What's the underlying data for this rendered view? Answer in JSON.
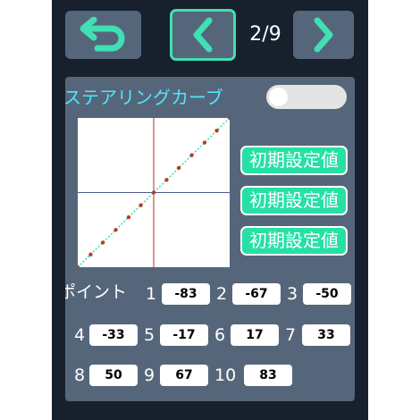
{
  "nav": {
    "back_icon": "undo-arrow-icon",
    "prev_icon": "chevron-left-icon",
    "next_icon": "chevron-right-icon",
    "page_indicator": "2/9"
  },
  "colors": {
    "background": "#17202d",
    "button": "#56667a",
    "accent": "#3fe0b3",
    "title": "#4fe6ff",
    "reset_button": "#27e0a6",
    "curve_line": "#3fe0b3",
    "curve_point": "#c0392b"
  },
  "section": {
    "title": "ステアリングカーブ",
    "toggle_on": false
  },
  "reset_buttons": [
    "初期設定値",
    "初期設定値",
    "初期設定値"
  ],
  "points_label": "ポイント",
  "points": [
    {
      "index": "1",
      "value": "-83"
    },
    {
      "index": "2",
      "value": "-67"
    },
    {
      "index": "3",
      "value": "-50"
    },
    {
      "index": "4",
      "value": "-33"
    },
    {
      "index": "5",
      "value": "-17"
    },
    {
      "index": "6",
      "value": "17"
    },
    {
      "index": "7",
      "value": "33"
    },
    {
      "index": "8",
      "value": "50"
    },
    {
      "index": "9",
      "value": "67"
    },
    {
      "index": "10",
      "value": "83"
    }
  ],
  "chart_data": {
    "type": "line",
    "x": [
      -100,
      -83,
      -67,
      -50,
      -33,
      -17,
      0,
      17,
      33,
      50,
      67,
      83,
      100
    ],
    "y": [
      -100,
      -83,
      -67,
      -50,
      -33,
      -17,
      0,
      17,
      33,
      50,
      67,
      83,
      100
    ],
    "xlim": [
      -100,
      100
    ],
    "ylim": [
      -100,
      100
    ]
  }
}
